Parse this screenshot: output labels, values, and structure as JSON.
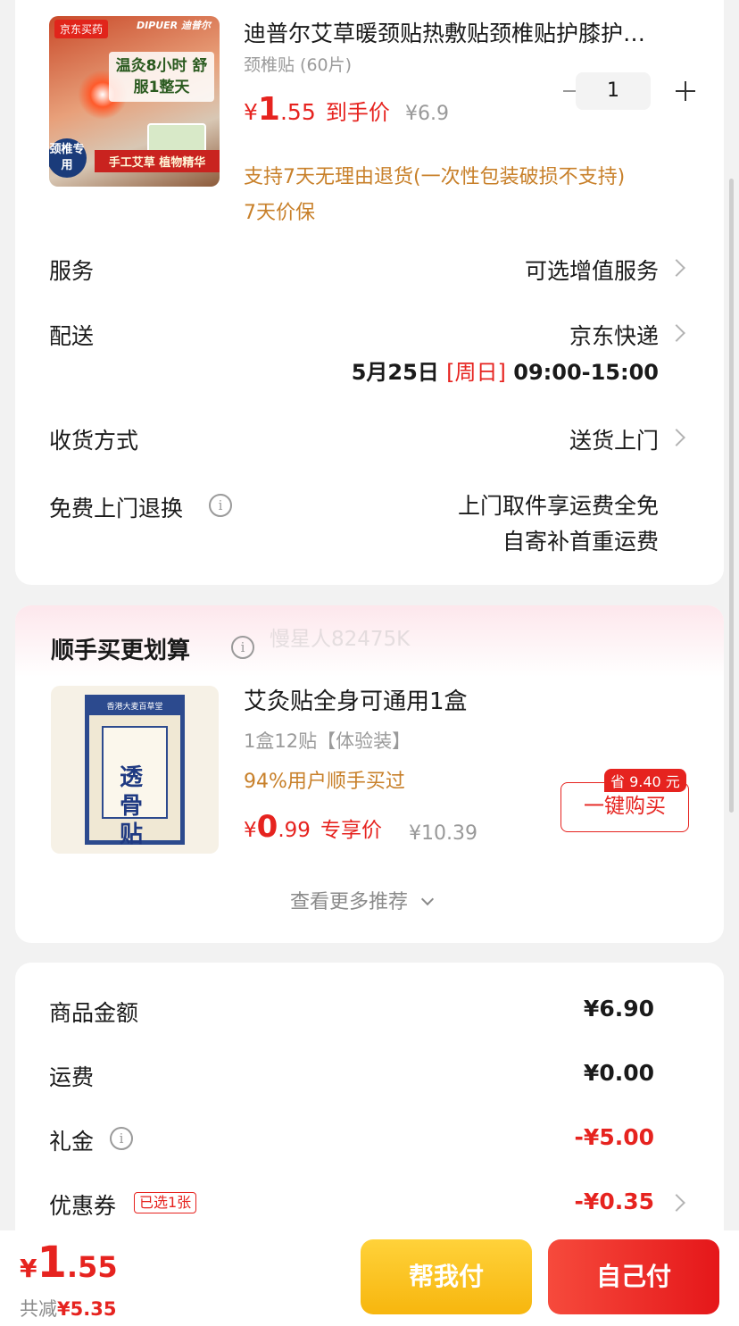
{
  "product": {
    "image": {
      "tag": "京东买药",
      "brand": "DIPUER 迪普尔",
      "slogan": "温灸8小时 舒服1整天",
      "badge": "颈椎专用",
      "bottom_text": "手工艾草 植物精华"
    },
    "title": "迪普尔艾草暖颈贴热敷贴颈椎贴护膝护…",
    "spec": "颈椎贴 (60片)",
    "price_symbol": "¥",
    "price_int": "1",
    "price_dec": ".55",
    "price_label": "到手价",
    "original_price": "¥6.9",
    "quantity": "1",
    "return_policy": "支持7天无理由退货(一次性包装破损不支持)",
    "price_protect": "7天价保"
  },
  "rows": {
    "service": {
      "label": "服务",
      "value": "可选增值服务"
    },
    "delivery": {
      "label": "配送",
      "value": "京东快递",
      "date": "5月25日",
      "weekday": "[周日]",
      "time": "09:00-15:00"
    },
    "receive": {
      "label": "收货方式",
      "value": "送货上门"
    },
    "free_return": {
      "label": "免费上门退换",
      "line1": "上门取件享运费全免",
      "line2": "自寄补首重运费"
    }
  },
  "recommend": {
    "heading": "顺手买更划算",
    "watermark": "慢星人82475K",
    "item": {
      "image": {
        "top_text": "香港大麦百草堂",
        "title": "透骨贴"
      },
      "title": "艾灸贴全身可通用1盒",
      "spec": "1盒12贴【体验装】",
      "social": "94%用户顺手买过",
      "price_symbol": "¥",
      "price_int": "0",
      "price_dec": ".99",
      "price_label": "专享价",
      "original_price": "¥10.39",
      "save_tag": "省 9.40 元",
      "buy_label": "一键购买"
    },
    "more_label": "查看更多推荐"
  },
  "summary": {
    "goods_amount": {
      "label": "商品金额",
      "value": "¥6.90"
    },
    "shipping": {
      "label": "运费",
      "value": "¥0.00"
    },
    "gift": {
      "label": "礼金",
      "value": "-¥5.00"
    },
    "coupon": {
      "label": "优惠券",
      "tag": "已选1张",
      "value": "-¥0.35"
    }
  },
  "footer": {
    "price_symbol": "¥",
    "price_int": "1",
    "price_dec": ".55",
    "discount_label": "共减",
    "discount_value": "¥5.35",
    "help_pay": "帮我付",
    "self_pay": "自己付"
  },
  "colors": {
    "accent_red": "#e6231f",
    "orange_text": "#c8802a",
    "yellow_button": "#f7b60e"
  }
}
